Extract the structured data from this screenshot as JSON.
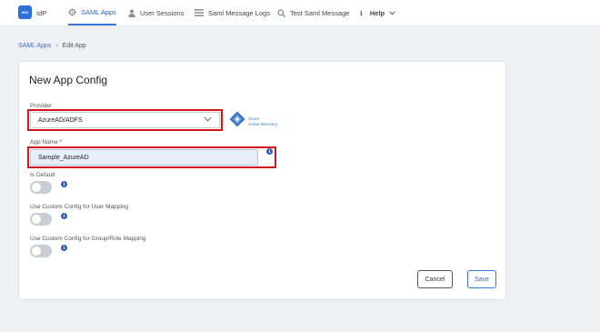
{
  "nav": {
    "brand_logo_text": "SSO",
    "items": [
      {
        "label": "IdP",
        "icon": "idp-logo-icon"
      },
      {
        "label": "SAML Apps",
        "icon": "gear-icon",
        "active": true
      },
      {
        "label": "User Sessions",
        "icon": "user-icon"
      },
      {
        "label": "Saml Message Logs",
        "icon": "list-icon"
      },
      {
        "label": "Test Saml Message",
        "icon": "search-icon"
      },
      {
        "label": "Help",
        "icon": "info-icon",
        "dropdown": true
      }
    ]
  },
  "breadcrumb": {
    "parent": "SAML Apps",
    "separator": "›",
    "current": "Edit App"
  },
  "form": {
    "title": "New App Config",
    "provider": {
      "label": "Provider",
      "value": "AzureAD/ADFS",
      "logo_text_line1": "Azure",
      "logo_text_line2": "Active Directory"
    },
    "app_name": {
      "label": "App Name",
      "required_mark": "*",
      "value": "Sample_AzureAD"
    },
    "is_default": {
      "label": "Is Default",
      "enabled": false
    },
    "custom_user_mapping": {
      "label": "Use Custom Config for User Mapping",
      "enabled": false
    },
    "custom_group_mapping": {
      "label": "Use Custom Config for Group/Role Mapping",
      "enabled": false
    },
    "info_glyph": "i",
    "cancel_label": "Cancel",
    "save_label": "Save"
  },
  "colors": {
    "accent": "#3a73d9",
    "highlight": "#d4141e",
    "toggle_off": "#c9ced4",
    "background": "#eef0f3"
  }
}
